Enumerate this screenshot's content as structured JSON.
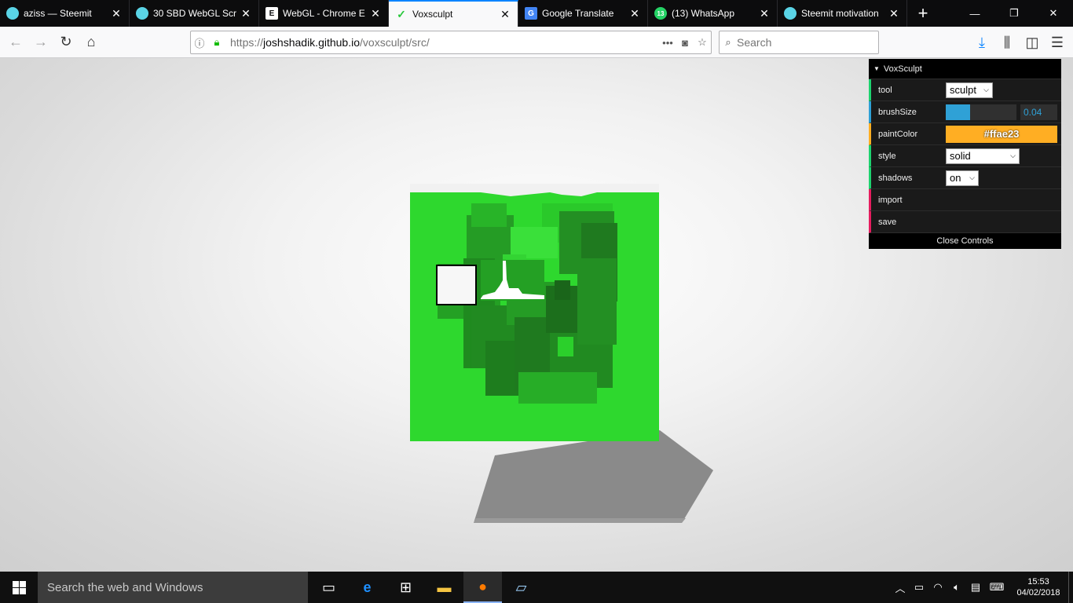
{
  "browser": {
    "tabs": [
      {
        "title": "aziss — Steemit",
        "favicon": "steemit-icon",
        "favicon_color": "#5ad4e6",
        "active": false
      },
      {
        "title": "30 SBD WebGL Scre",
        "favicon": "steemit-icon",
        "favicon_color": "#5ad4e6",
        "active": false
      },
      {
        "title": "WebGL - Chrome E",
        "favicon": "e-letter-icon",
        "favicon_color": "#ffffff",
        "active": false
      },
      {
        "title": "Voxsculpt",
        "favicon": "voxsculpt-icon",
        "favicon_color": "#28c83c",
        "active": true
      },
      {
        "title": "Google Translate",
        "favicon": "google-translate-icon",
        "favicon_color": "#4285f4",
        "active": false
      },
      {
        "title": "(13) WhatsApp",
        "favicon": "whatsapp-icon",
        "favicon_color": "#25d366",
        "active": false
      },
      {
        "title": "Steemit motivation",
        "favicon": "steemit-icon",
        "favicon_color": "#5ad4e6",
        "active": false
      }
    ],
    "url_prefix": "https://",
    "url_host": "joshshadik.github.io",
    "url_path": "/voxsculpt/src/",
    "search_placeholder": "Search"
  },
  "gui": {
    "title": "VoxSculpt",
    "tool_label": "tool",
    "tool_value": "sculpt",
    "brushsize_label": "brushSize",
    "brushsize_value": "0.04",
    "brushsize_fraction": 0.34,
    "paintcolor_label": "paintColor",
    "paintcolor_value": "#ffae23",
    "style_label": "style",
    "style_value": "solid",
    "shadows_label": "shadows",
    "shadows_value": "on",
    "import_label": "import",
    "save_label": "save",
    "close_label": "Close Controls"
  },
  "taskbar": {
    "search_placeholder": "Search the web and Windows",
    "time": "15:53",
    "date": "04/02/2018"
  },
  "colors": {
    "voxel_green": "#2ed82e",
    "voxel_dark_green": "#1f7a1f",
    "accent_blue": "#2fa1d6",
    "paint_orange": "#ffae23"
  }
}
